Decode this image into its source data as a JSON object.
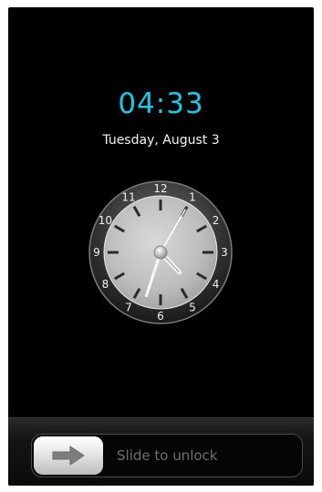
{
  "lockscreen": {
    "time": "04:33",
    "date": "Tuesday, August 3",
    "accent_color": "#19c9e8"
  },
  "clock": {
    "numerals": [
      "12",
      "1",
      "2",
      "3",
      "4",
      "5",
      "6",
      "7",
      "8",
      "9",
      "10",
      "11"
    ],
    "hour": 4,
    "minute": 33,
    "second": 5
  },
  "unlock": {
    "label": "Slide to unlock",
    "knob_icon": "arrow-right-icon"
  }
}
